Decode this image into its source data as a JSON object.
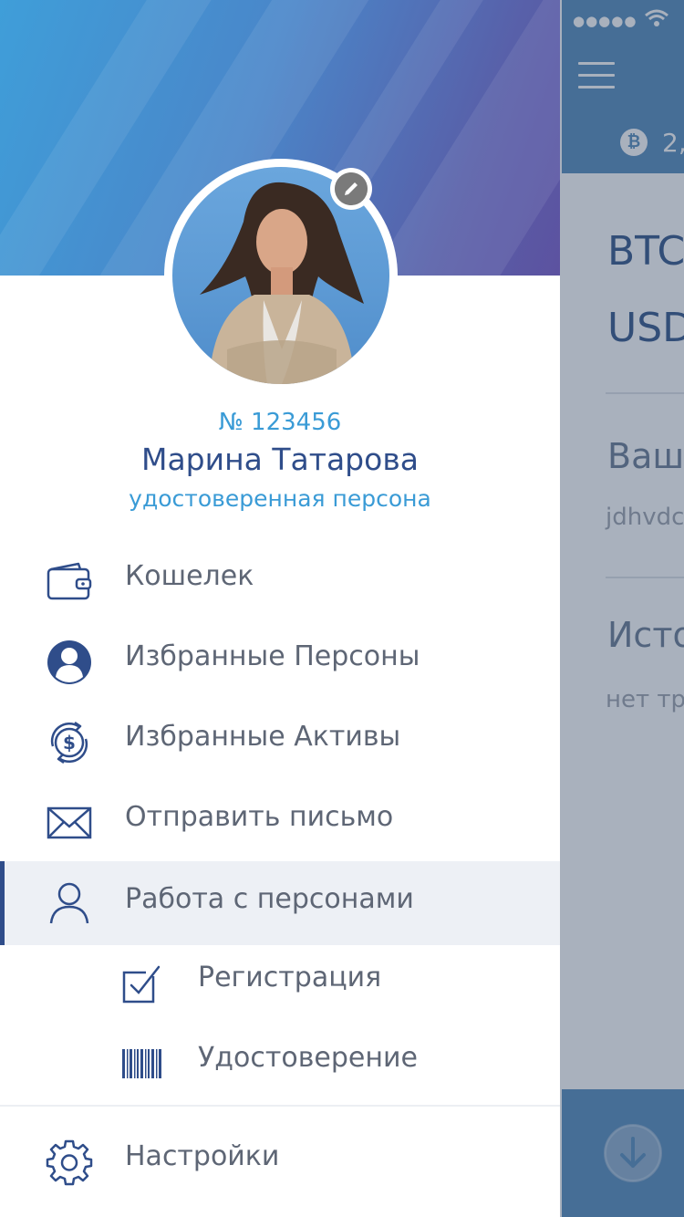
{
  "background_app": {
    "balance": "2,",
    "btc_label": "BTC",
    "usd_label": "USD",
    "wallet_heading": "Ваш",
    "wallet_address": "jdhvdc",
    "history_heading": "Исто",
    "history_empty": "нет тр",
    "status_dots": "●●●●●"
  },
  "drawer": {
    "user": {
      "number": "№ 123456",
      "name": "Марина Татарова",
      "status": "удостоверенная персона"
    },
    "menu": [
      {
        "label": "Кошелек",
        "icon": "wallet-icon"
      },
      {
        "label": "Избранные Персоны",
        "icon": "person-circle-icon"
      },
      {
        "label": "Избранные Активы",
        "icon": "dollar-exchange-icon"
      },
      {
        "label": "Отправить письмо",
        "icon": "envelope-icon"
      },
      {
        "label": "Работа с персонами",
        "icon": "user-outline-icon",
        "active": true
      },
      {
        "label": "Регистрация",
        "icon": "checkbox-icon",
        "sub": true
      },
      {
        "label": "Удостоверение",
        "icon": "barcode-icon",
        "sub": true
      },
      {
        "label": "Настройки",
        "icon": "gear-icon"
      }
    ]
  },
  "colors": {
    "accent": "#3a9bd6",
    "primary": "#2f4d8a",
    "active_bg": "#edf0f5"
  }
}
